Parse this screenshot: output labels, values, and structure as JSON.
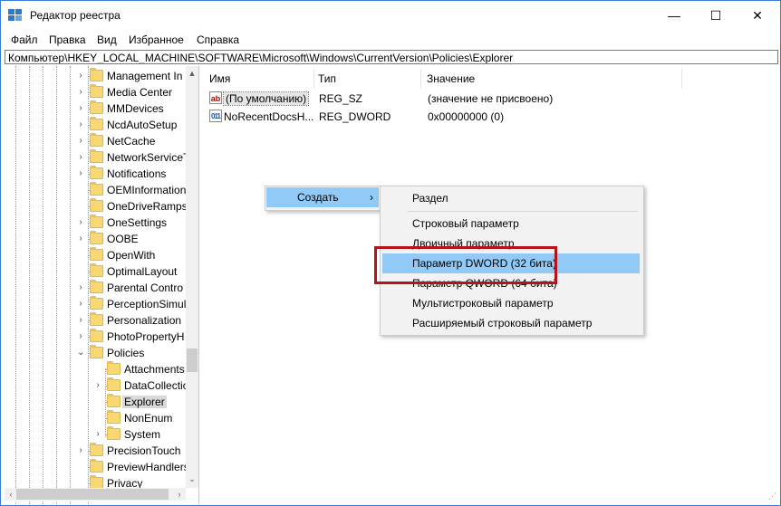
{
  "window": {
    "title": "Редактор реестра",
    "app_icon": "regedit-icon",
    "controls": {
      "minimize": "—",
      "maximize": "☐",
      "close": "✕"
    }
  },
  "menubar": {
    "items": [
      "Файл",
      "Правка",
      "Вид",
      "Избранное",
      "Справка"
    ]
  },
  "addressbar": {
    "path": "Компьютер\\HKEY_LOCAL_MACHINE\\SOFTWARE\\Microsoft\\Windows\\CurrentVersion\\Policies\\Explorer"
  },
  "tree": {
    "items": [
      {
        "label": "Management In",
        "level": 1,
        "expander": "›"
      },
      {
        "label": "Media Center",
        "level": 1,
        "expander": "›"
      },
      {
        "label": "MMDevices",
        "level": 1,
        "expander": "›"
      },
      {
        "label": "NcdAutoSetup",
        "level": 1,
        "expander": "›"
      },
      {
        "label": "NetCache",
        "level": 1,
        "expander": "›"
      },
      {
        "label": "NetworkServiceT",
        "level": 1,
        "expander": "›"
      },
      {
        "label": "Notifications",
        "level": 1,
        "expander": "›"
      },
      {
        "label": "OEMInformation",
        "level": 1,
        "expander": ""
      },
      {
        "label": "OneDriveRamps",
        "level": 1,
        "expander": ""
      },
      {
        "label": "OneSettings",
        "level": 1,
        "expander": "›"
      },
      {
        "label": "OOBE",
        "level": 1,
        "expander": "›"
      },
      {
        "label": "OpenWith",
        "level": 1,
        "expander": ""
      },
      {
        "label": "OptimalLayout",
        "level": 1,
        "expander": ""
      },
      {
        "label": "Parental Contro",
        "level": 1,
        "expander": "›"
      },
      {
        "label": "PerceptionSimul",
        "level": 1,
        "expander": "›"
      },
      {
        "label": "Personalization",
        "level": 1,
        "expander": "›"
      },
      {
        "label": "PhotoPropertyH",
        "level": 1,
        "expander": "›"
      },
      {
        "label": "Policies",
        "level": 1,
        "expander": "⌄"
      },
      {
        "label": "Attachments",
        "level": 2,
        "expander": ""
      },
      {
        "label": "DataCollection",
        "level": 2,
        "expander": "›"
      },
      {
        "label": "Explorer",
        "level": 2,
        "expander": "",
        "selected": true
      },
      {
        "label": "NonEnum",
        "level": 2,
        "expander": ""
      },
      {
        "label": "System",
        "level": 2,
        "expander": "›"
      },
      {
        "label": "PrecisionTouch",
        "level": 1,
        "expander": "›"
      },
      {
        "label": "PreviewHandlers",
        "level": 1,
        "expander": ""
      },
      {
        "label": "Privacy",
        "level": 1,
        "expander": ""
      }
    ]
  },
  "scrollbars": {
    "up": "▲",
    "down": "⌄",
    "left": "‹",
    "right": "›"
  },
  "list": {
    "columns": [
      "Имя",
      "Тип",
      "Значение"
    ],
    "rows": [
      {
        "icon": "ab",
        "icon_name": "string-value-icon",
        "name": "(По умолчанию)",
        "type": "REG_SZ",
        "value": "(значение не присвоено)"
      },
      {
        "icon": "011",
        "icon_name": "binary-value-icon",
        "name": "NoRecentDocsH...",
        "type": "REG_DWORD",
        "value": "0x00000000 (0)"
      }
    ]
  },
  "context_menu": {
    "label": "Создать",
    "arrow": "›"
  },
  "submenu": {
    "items": [
      "Раздел",
      "Строковый параметр",
      "Двоичный параметр",
      "Параметр DWORD (32 бита)",
      "Параметр QWORD (64 бита)",
      "Мультистроковый параметр",
      "Расширяемый строковый параметр"
    ],
    "highlighted_index": 3,
    "highlight_color": "#91c9f7",
    "annotation_color": "#b5121b"
  }
}
